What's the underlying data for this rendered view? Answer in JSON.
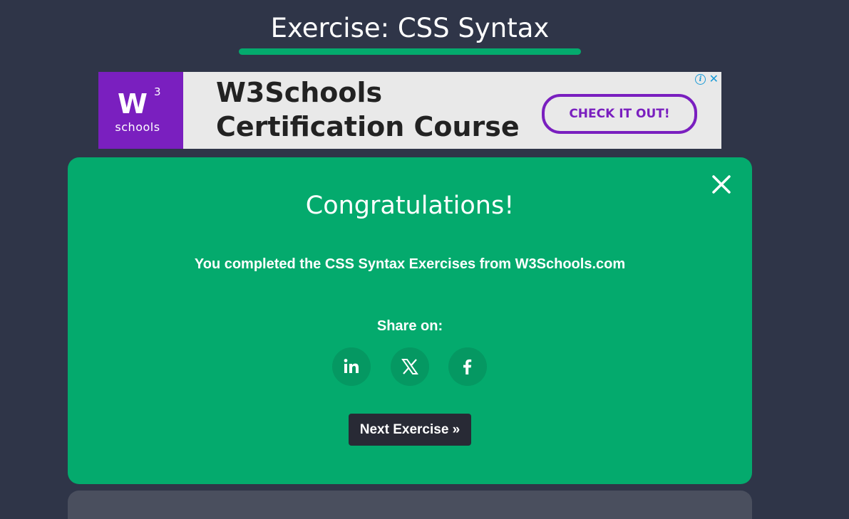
{
  "page": {
    "title": "Exercise: CSS Syntax"
  },
  "ad": {
    "logo_mark": "W",
    "logo_superscript": "3",
    "logo_text": "schools",
    "headline_line1": "W3Schools",
    "headline_line2": "Certification Course",
    "cta_label": "CHECK IT OUT!",
    "info_icon": "info-icon",
    "close_icon": "close-icon",
    "brand_color": "#7a1fbf"
  },
  "modal": {
    "heading": "Congratulations!",
    "message": "You completed the CSS Syntax Exercises from W3Schools.com",
    "share_label": "Share on:",
    "share_buttons": [
      {
        "name": "linkedin",
        "icon": "linkedin-icon"
      },
      {
        "name": "x",
        "icon": "x-icon"
      },
      {
        "name": "facebook",
        "icon": "facebook-icon"
      }
    ],
    "next_label": "Next Exercise »",
    "close_icon": "close-icon",
    "background_color": "#04aa6d"
  },
  "theme": {
    "page_background": "#2f3548",
    "accent_green": "#04aa6d",
    "button_dark": "#282a35"
  }
}
